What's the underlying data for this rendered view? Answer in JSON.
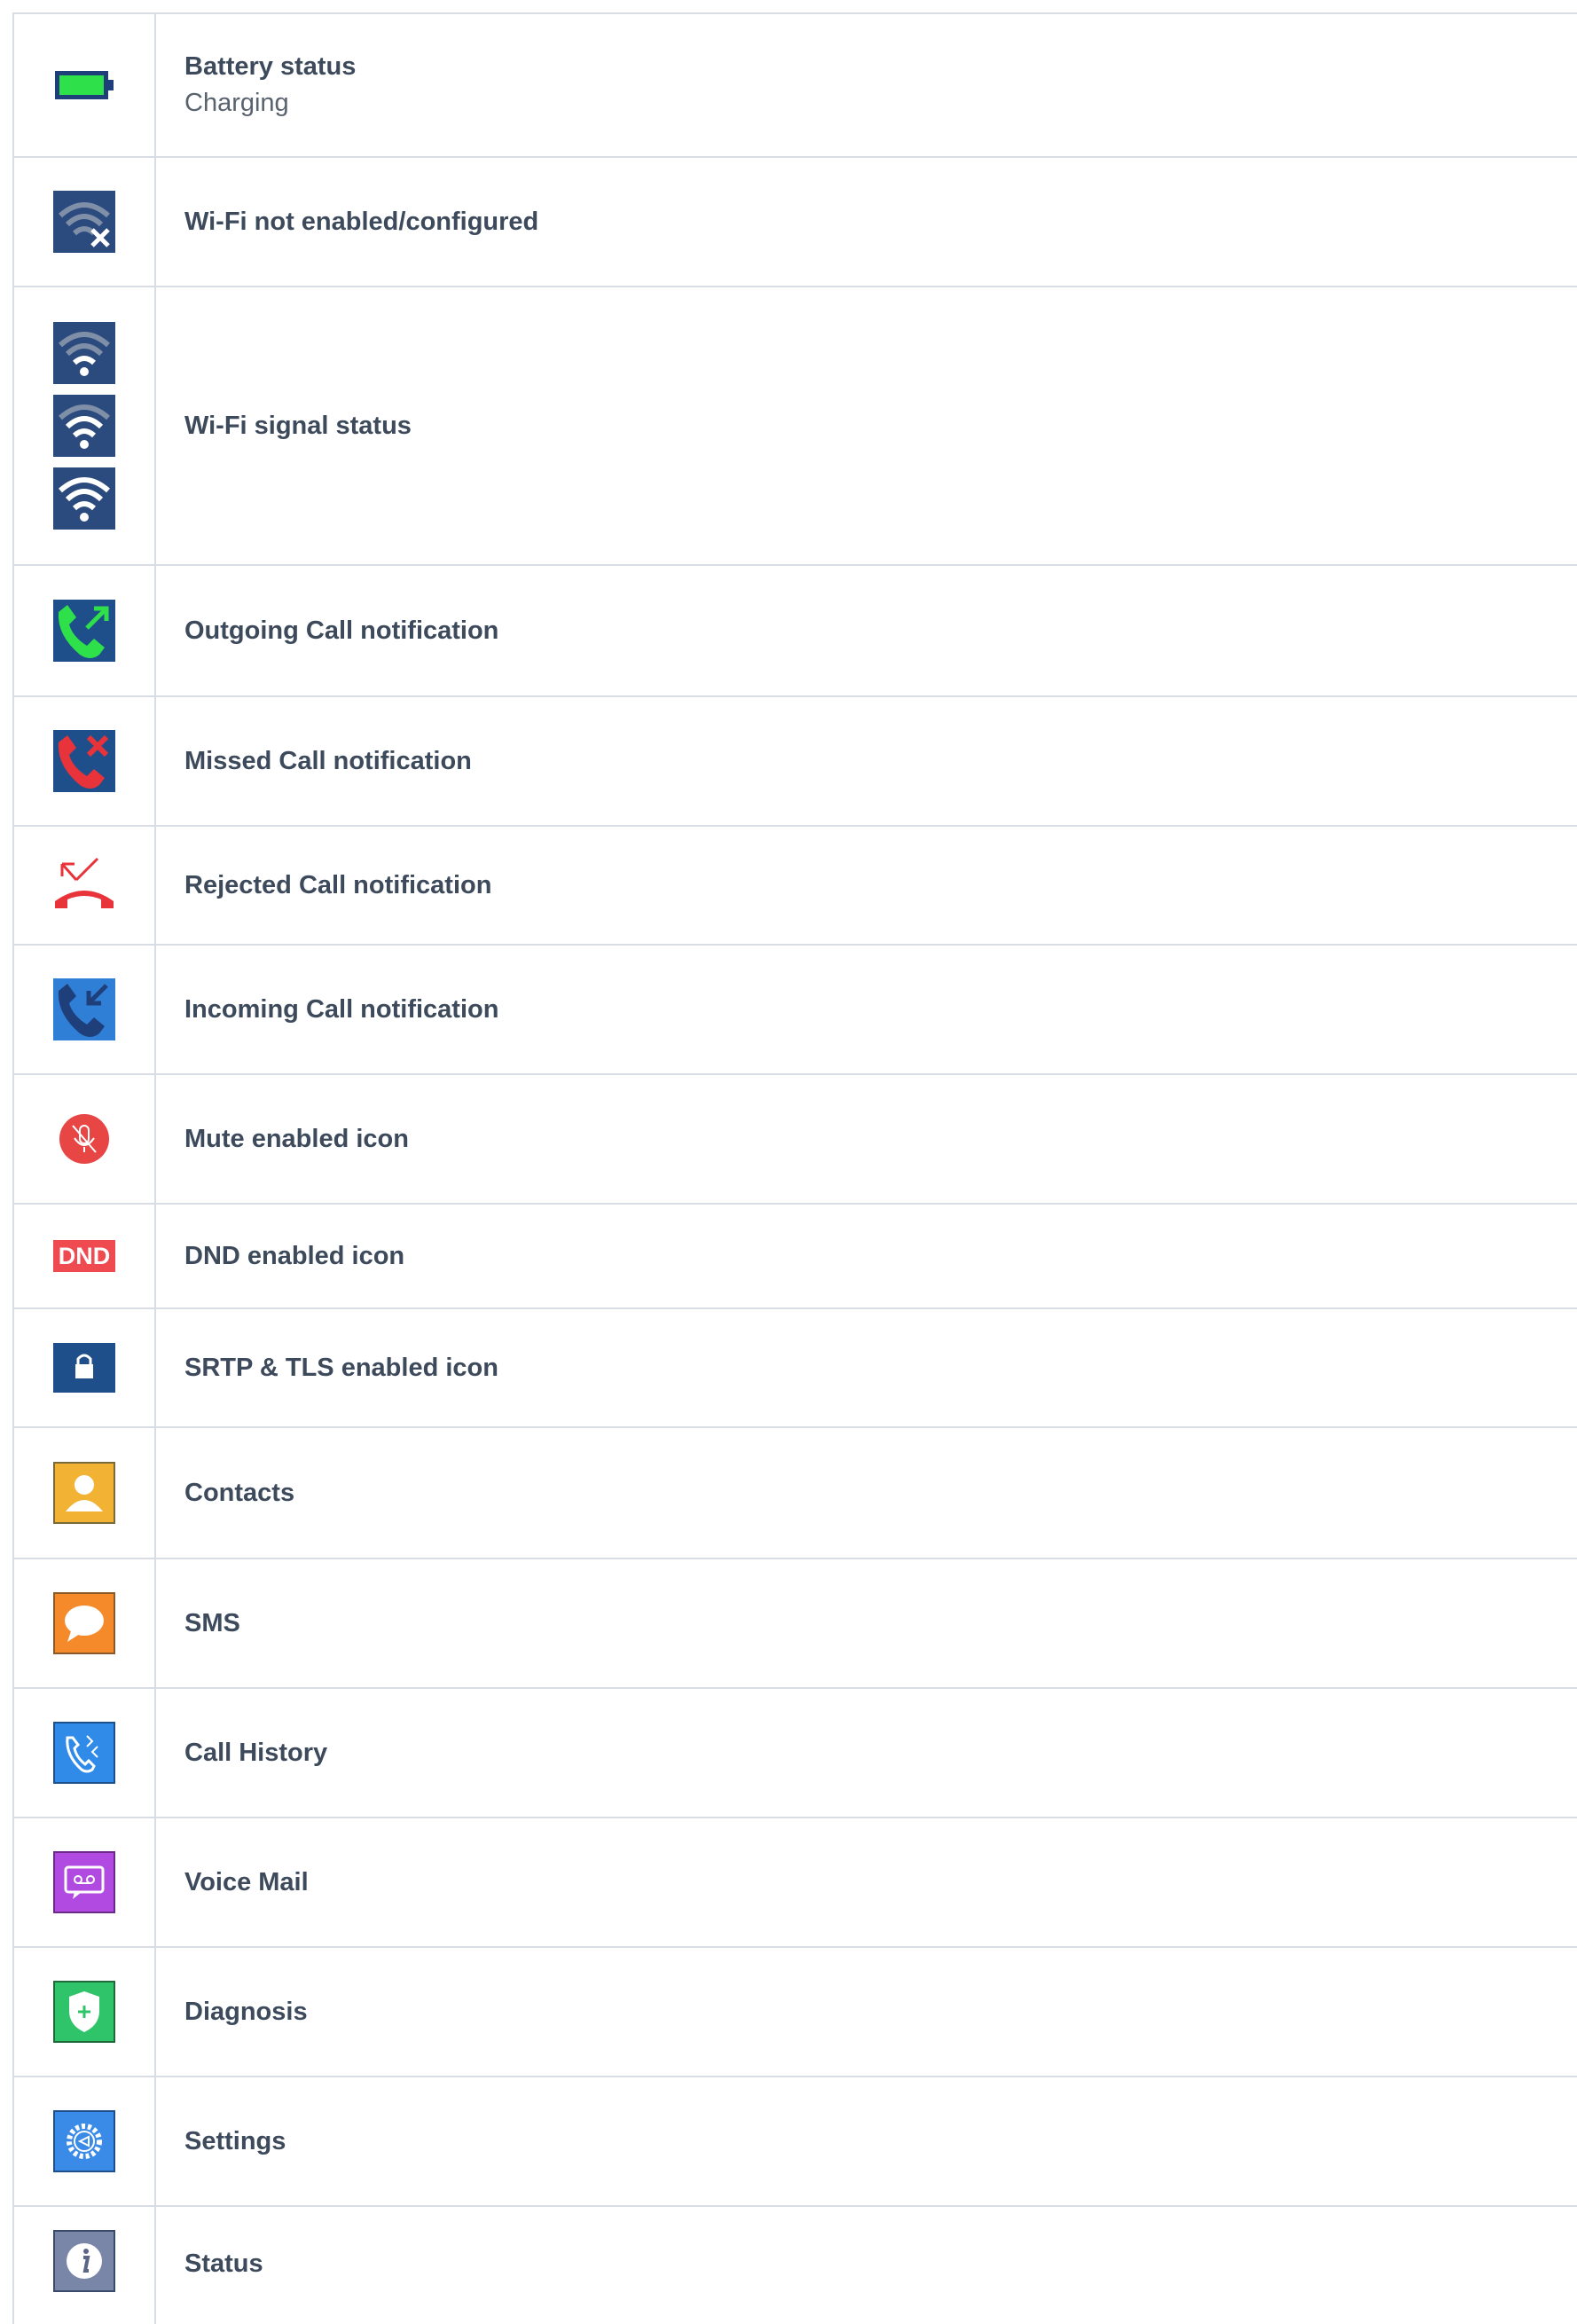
{
  "rows": [
    {
      "label": "Battery status",
      "sub": "Charging",
      "icon": "battery-charging-icon"
    },
    {
      "label": "Wi-Fi not enabled/configured",
      "icon": "wifi-off-icon"
    },
    {
      "label": "Wi-Fi signal status",
      "icon": "wifi-signal-icon"
    },
    {
      "label": "Outgoing Call notification",
      "icon": "outgoing-call-icon"
    },
    {
      "label": "Missed Call notification",
      "icon": "missed-call-icon"
    },
    {
      "label": "Rejected Call notification",
      "icon": "rejected-call-icon"
    },
    {
      "label": "Incoming Call notification",
      "icon": "incoming-call-icon"
    },
    {
      "label": "Mute enabled icon",
      "icon": "mute-icon"
    },
    {
      "label": "DND enabled icon",
      "icon": "dnd-icon",
      "icon_text": "DND"
    },
    {
      "label": "SRTP & TLS enabled icon",
      "icon": "lock-icon"
    },
    {
      "label": "Contacts",
      "icon": "contacts-icon"
    },
    {
      "label": "SMS",
      "icon": "sms-icon"
    },
    {
      "label": "Call History",
      "icon": "call-history-icon"
    },
    {
      "label": "Voice Mail",
      "icon": "voicemail-icon"
    },
    {
      "label": "Diagnosis",
      "icon": "diagnosis-icon"
    },
    {
      "label": "Settings",
      "icon": "settings-icon"
    },
    {
      "label": "Status",
      "icon": "status-icon"
    }
  ],
  "colors": {
    "border": "#d8dde3",
    "text": "#3d4a5c",
    "navy": "#2b4a7e",
    "green": "#2ecc40",
    "red": "#e8333a",
    "blue": "#2f7fd6"
  }
}
